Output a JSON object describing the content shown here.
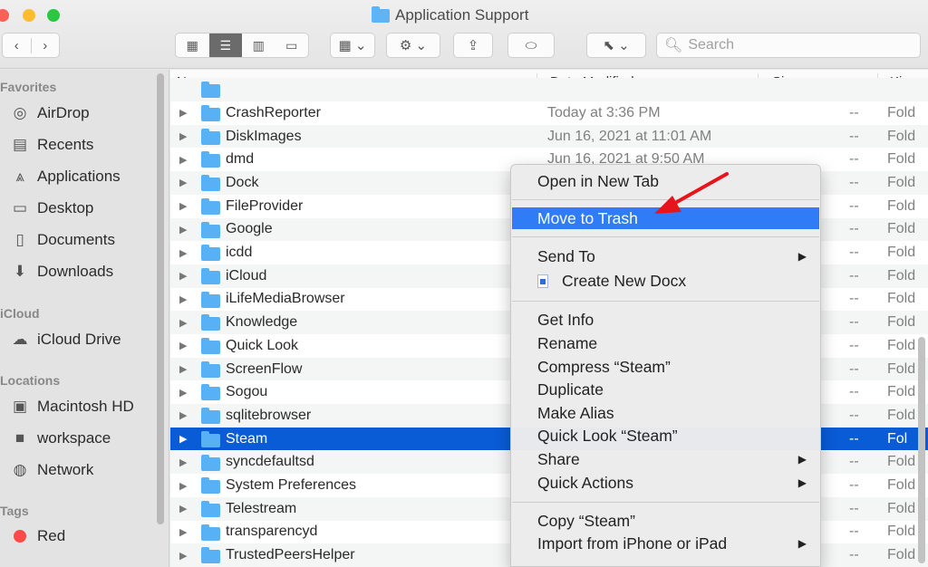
{
  "window": {
    "title": "Application Support"
  },
  "toolbar": {
    "back": "‹",
    "forward": "›",
    "views": [
      "▦",
      "☰",
      "▥",
      "▭"
    ],
    "group": "▦ ⌄",
    "action": "⚙ ⌄",
    "share": "⇪",
    "tag": "⬭",
    "cursor": "⬉ ⌄",
    "search_placeholder": "Search"
  },
  "sidebar": {
    "favorites_title": "Favorites",
    "favorites": [
      {
        "label": "AirDrop",
        "icon": "airdrop-icon",
        "glyph": "◎"
      },
      {
        "label": "Recents",
        "icon": "recents-icon",
        "glyph": "▤"
      },
      {
        "label": "Applications",
        "icon": "applications-icon",
        "glyph": "⩓"
      },
      {
        "label": "Desktop",
        "icon": "desktop-icon",
        "glyph": "▭"
      },
      {
        "label": "Documents",
        "icon": "documents-icon",
        "glyph": "▯"
      },
      {
        "label": "Downloads",
        "icon": "downloads-icon",
        "glyph": "⬇"
      }
    ],
    "icloud_title": "iCloud",
    "icloud": [
      {
        "label": "iCloud Drive",
        "icon": "cloud-icon",
        "glyph": "☁"
      }
    ],
    "locations_title": "Locations",
    "locations": [
      {
        "label": "Macintosh HD",
        "icon": "harddisk-icon",
        "glyph": "▣"
      },
      {
        "label": "workspace",
        "icon": "drive-icon",
        "glyph": "■"
      },
      {
        "label": "Network",
        "icon": "network-icon",
        "glyph": "◍"
      }
    ],
    "tags_title": "Tags",
    "tags": [
      {
        "label": "Red",
        "color": "#ff4a4a"
      }
    ]
  },
  "columns": {
    "name": "Name",
    "date": "Date Modified",
    "size": "Size",
    "kind": "Kin"
  },
  "files": [
    {
      "name": "CrashReporter",
      "date": "Today at 3:36 PM",
      "size": "--",
      "kind": "Fold"
    },
    {
      "name": "DiskImages",
      "date": "Jun 16, 2021 at 11:01 AM",
      "size": "--",
      "kind": "Fold"
    },
    {
      "name": "dmd",
      "date": "Jun 16, 2021 at 9:50 AM",
      "size": "--",
      "kind": "Fold"
    },
    {
      "name": "Dock",
      "date": "",
      "size": "--",
      "kind": "Fold"
    },
    {
      "name": "FileProvider",
      "date": "",
      "size": "--",
      "kind": "Fold"
    },
    {
      "name": "Google",
      "date": "",
      "size": "--",
      "kind": "Fold"
    },
    {
      "name": "icdd",
      "date": "",
      "size": "--",
      "kind": "Fold"
    },
    {
      "name": "iCloud",
      "date": "",
      "size": "--",
      "kind": "Fold"
    },
    {
      "name": "iLifeMediaBrowser",
      "date": "",
      "size": "--",
      "kind": "Fold"
    },
    {
      "name": "Knowledge",
      "date": "",
      "size": "--",
      "kind": "Fold"
    },
    {
      "name": "Quick Look",
      "date": "",
      "size": "--",
      "kind": "Fold"
    },
    {
      "name": "ScreenFlow",
      "date": "",
      "size": "--",
      "kind": "Fold"
    },
    {
      "name": "Sogou",
      "date": "",
      "size": "--",
      "kind": "Fold"
    },
    {
      "name": "sqlitebrowser",
      "date": "",
      "size": "--",
      "kind": "Fold"
    },
    {
      "name": "Steam",
      "date": "",
      "size": "--",
      "kind": "Fol",
      "selected": true
    },
    {
      "name": "syncdefaultsd",
      "date": "",
      "size": "--",
      "kind": "Fold"
    },
    {
      "name": "System Preferences",
      "date": "",
      "size": "--",
      "kind": "Fold"
    },
    {
      "name": "Telestream",
      "date": "",
      "size": "--",
      "kind": "Fold"
    },
    {
      "name": "transparencyd",
      "date": "",
      "size": "--",
      "kind": "Fold"
    },
    {
      "name": "TrustedPeersHelper",
      "date": "",
      "size": "--",
      "kind": "Fold"
    }
  ],
  "context_menu": {
    "open_new_tab": "Open in New Tab",
    "move_to_trash": "Move to Trash",
    "send_to": "Send To",
    "create_docx": "Create New Docx",
    "get_info": "Get Info",
    "rename": "Rename",
    "compress": "Compress “Steam”",
    "duplicate": "Duplicate",
    "make_alias": "Make Alias",
    "quick_look": "Quick Look “Steam”",
    "share": "Share",
    "quick_actions": "Quick Actions",
    "copy": "Copy “Steam”",
    "import": "Import from iPhone or iPad",
    "submenu_glyph": "▶"
  },
  "colors": {
    "selection": "#0a5bd6",
    "menu_highlight": "#2f7cf6",
    "annotation_arrow": "#e8141c",
    "folder": "#58b1f4"
  }
}
